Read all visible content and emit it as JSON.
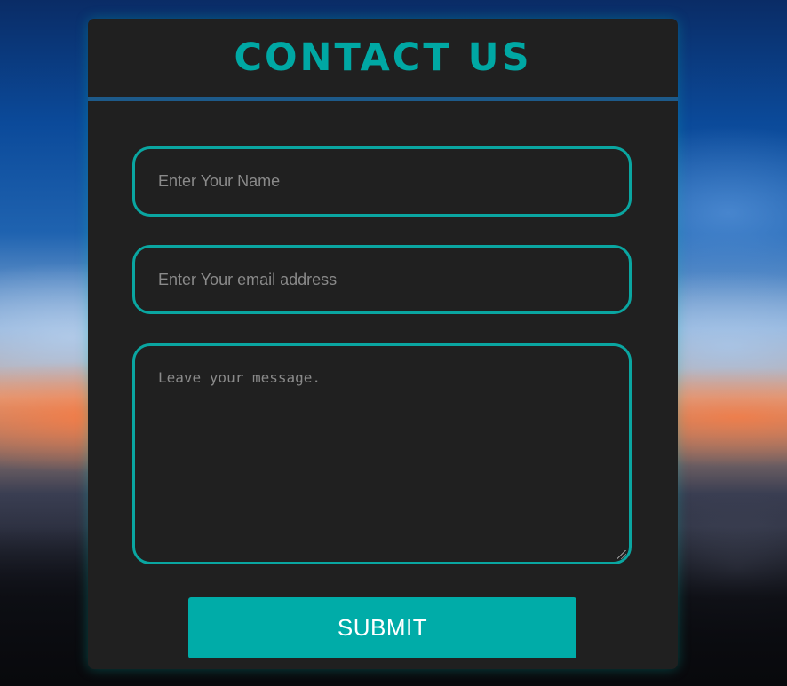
{
  "header": {
    "title": "CONTACT US"
  },
  "form": {
    "name_placeholder": "Enter Your Name",
    "email_placeholder": "Enter Your email address",
    "message_placeholder": "Leave your message.",
    "submit_label": "SUBMIT"
  },
  "colors": {
    "accent": "#00a8a4",
    "card_background": "#202020",
    "header_divider": "#1d5a8a",
    "button_background": "#00aca8",
    "button_text": "#ffffff"
  }
}
